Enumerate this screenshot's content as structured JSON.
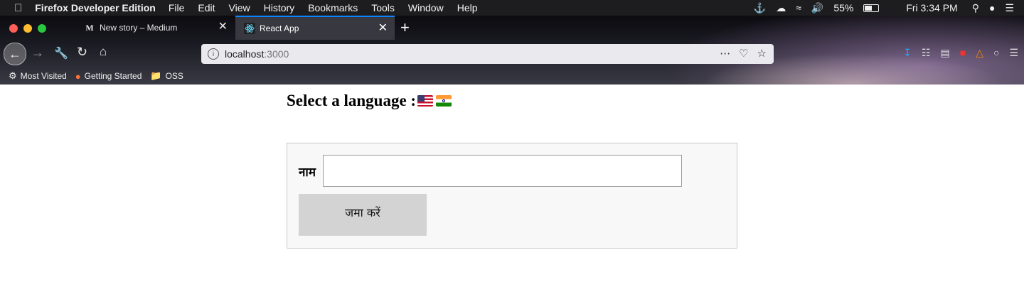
{
  "menubar": {
    "apple_icon": "apple-logo-icon",
    "app_name": "Firefox Developer Edition",
    "menus": [
      "File",
      "Edit",
      "View",
      "History",
      "Bookmarks",
      "Tools",
      "Window",
      "Help"
    ],
    "battery_percent": "55%",
    "battery_level": 0.55,
    "clock": "Fri 3:34 PM"
  },
  "tabs": [
    {
      "title": "New story – Medium",
      "favicon": "M",
      "active": false
    },
    {
      "title": "React App",
      "favicon": "react-icon",
      "active": true
    }
  ],
  "urlbar": {
    "host": "localhost",
    "port": ":3000"
  },
  "bookmarks": [
    {
      "label": "Most Visited",
      "icon": "gear-icon"
    },
    {
      "label": "Getting Started",
      "icon": "firefox-icon"
    },
    {
      "label": "OSS",
      "icon": "folder-icon"
    }
  ],
  "page": {
    "heading": "Select a language :",
    "flags": [
      "us-flag",
      "india-flag"
    ],
    "form": {
      "name_label": "नाम",
      "name_value": "",
      "submit_label": "जमा करें"
    }
  },
  "colors": {
    "accent": "#0a84ff",
    "menubar_bg": "#1d1d1f",
    "form_bg": "#f8f8f8",
    "button_bg": "#d3d3d3"
  }
}
